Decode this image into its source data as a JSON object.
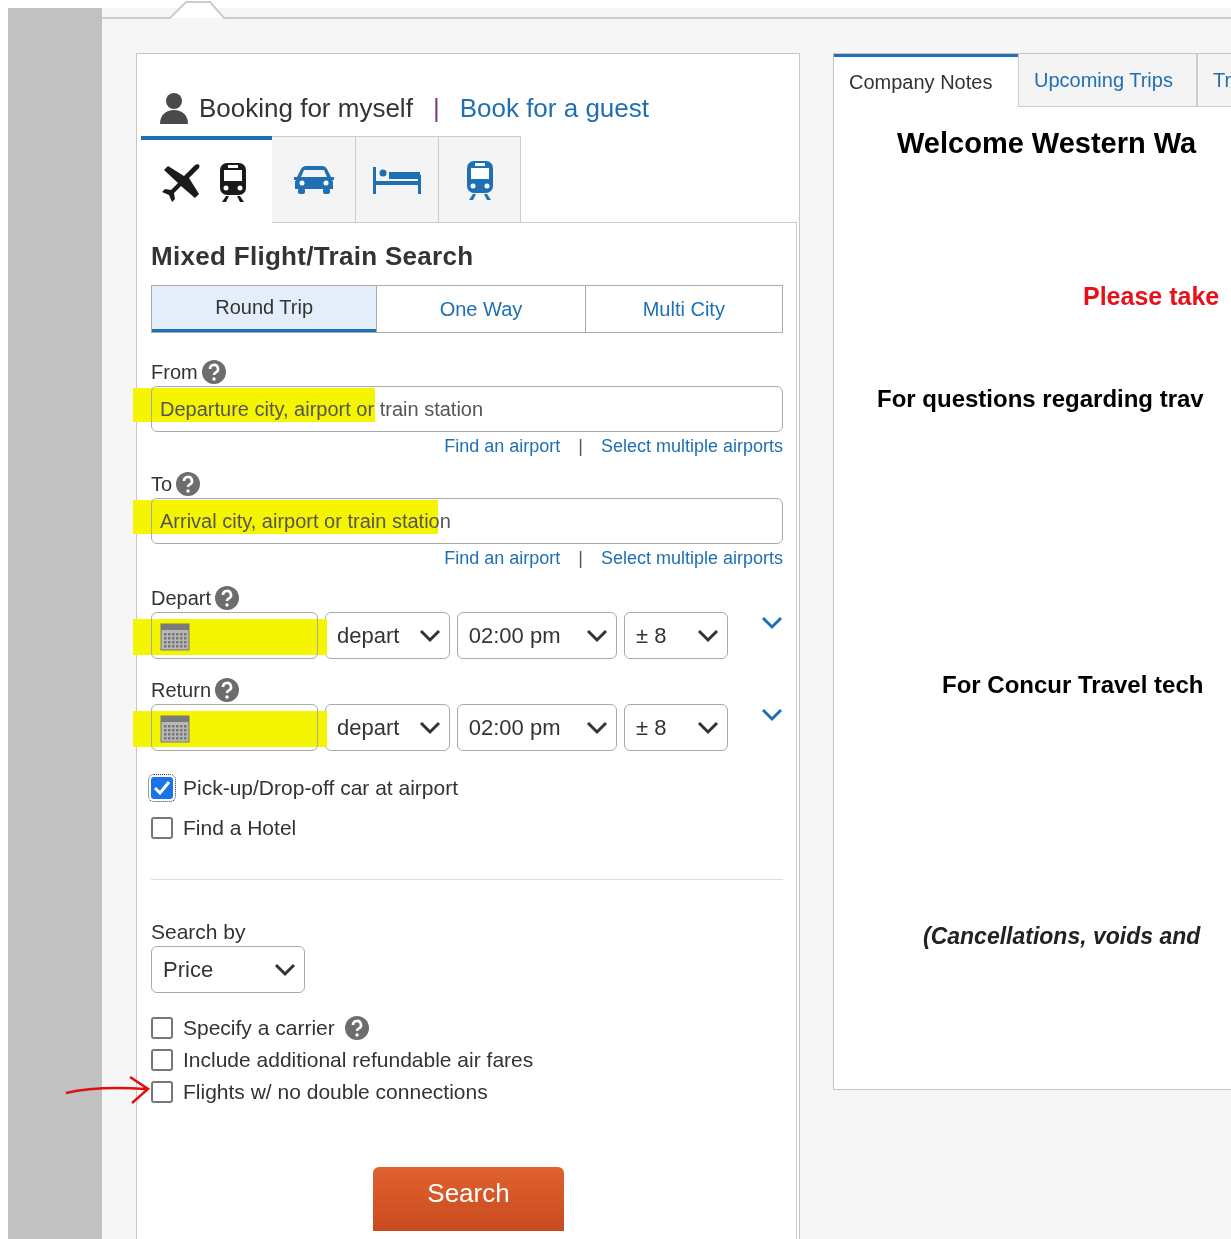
{
  "booking_for": {
    "self_label": "Booking for myself",
    "separator": "|",
    "guest_link": "Book for a guest"
  },
  "mode_tabs": [
    {
      "kind": "flight-train",
      "selected": true
    },
    {
      "kind": "car",
      "selected": false
    },
    {
      "kind": "hotel",
      "selected": false
    },
    {
      "kind": "train",
      "selected": false
    }
  ],
  "search_title": "Mixed Flight/Train Search",
  "trip_types": [
    {
      "label": "Round Trip",
      "selected": true
    },
    {
      "label": "One Way",
      "selected": false
    },
    {
      "label": "Multi City",
      "selected": false
    }
  ],
  "locations": [
    {
      "label": "From",
      "placeholder": "Departure city, airport or train station",
      "highlighted": true,
      "links": [
        "Find an airport",
        "|",
        "Select multiple airports"
      ]
    },
    {
      "label": "To",
      "placeholder": "Arrival city, airport or train station",
      "highlighted": true,
      "links": [
        "Find an airport",
        "|",
        "Select multiple airports"
      ]
    }
  ],
  "dates": [
    {
      "label": "Depart",
      "highlighted": true,
      "time_type": "depart",
      "time": "02:00 pm",
      "range": "± 8"
    },
    {
      "label": "Return",
      "highlighted": true,
      "time_type": "depart",
      "time": "02:00 pm",
      "range": "± 8"
    }
  ],
  "extras": [
    {
      "label": "Pick-up/Drop-off car at airport",
      "checked": true
    },
    {
      "label": "Find a Hotel",
      "checked": false
    }
  ],
  "search_by": {
    "label": "Search by",
    "value": "Price"
  },
  "filters": [
    {
      "label": "Specify a carrier",
      "help": true,
      "checked": false,
      "arrow_annotation": false
    },
    {
      "label": "Include additional refundable air fares",
      "help": false,
      "checked": false,
      "arrow_annotation": false
    },
    {
      "label": "Flights w/ no double connections",
      "help": false,
      "checked": false,
      "arrow_annotation": true
    }
  ],
  "search_button": "Search",
  "side_tabs": [
    {
      "label": "Company Notes",
      "selected": true
    },
    {
      "label": "Upcoming Trips",
      "selected": false
    },
    {
      "label": "Tr",
      "selected": false
    }
  ],
  "notes": [
    {
      "kind": "heading",
      "text": "Welcome Western Wa"
    },
    {
      "kind": "alert",
      "text": "Please take"
    },
    {
      "kind": "bold",
      "text": "For questions regarding trav"
    },
    {
      "kind": "bold",
      "text": "For Concur Travel tech"
    },
    {
      "kind": "italic",
      "text": "(Cancellations, voids and"
    }
  ]
}
